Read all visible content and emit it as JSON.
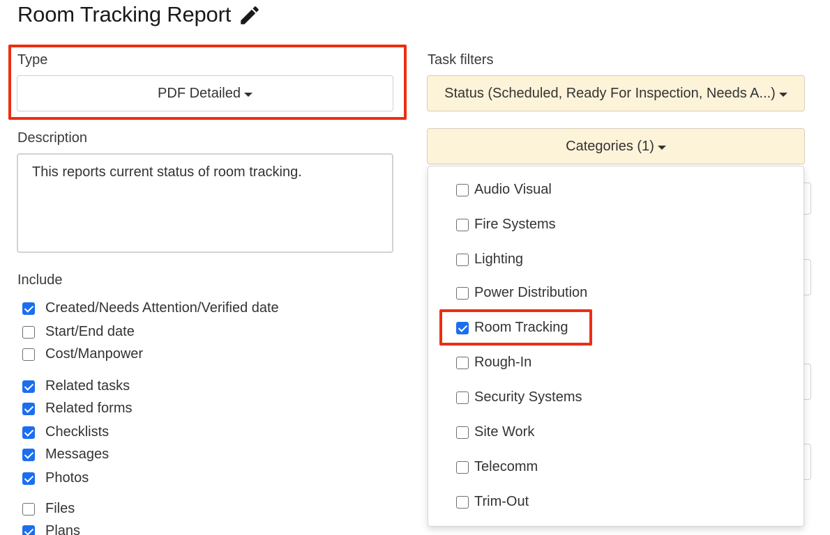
{
  "header": {
    "title": "Room Tracking Report"
  },
  "type": {
    "label": "Type",
    "value": "PDF Detailed"
  },
  "description": {
    "label": "Description",
    "value": "This reports current status of room tracking."
  },
  "include": {
    "label": "Include",
    "items": [
      {
        "label": "Created/Needs Attention/Verified date",
        "checked": true
      },
      {
        "label": "Start/End date",
        "checked": false
      },
      {
        "label": "Cost/Manpower",
        "checked": false
      },
      {
        "label": "Related tasks",
        "checked": true
      },
      {
        "label": "Related forms",
        "checked": true
      },
      {
        "label": "Checklists",
        "checked": true
      },
      {
        "label": "Messages",
        "checked": true
      },
      {
        "label": "Photos",
        "checked": true
      },
      {
        "label": "Files",
        "checked": false
      },
      {
        "label": "Plans",
        "checked": true
      }
    ]
  },
  "task_filters": {
    "label": "Task filters",
    "status_button": "Status (Scheduled, Ready For Inspection, Needs A...)",
    "categories_button": "Categories (1)",
    "categories": [
      {
        "label": "Audio Visual",
        "checked": false
      },
      {
        "label": "Fire Systems",
        "checked": false
      },
      {
        "label": "Lighting",
        "checked": false
      },
      {
        "label": "Power Distribution",
        "checked": false
      },
      {
        "label": "Room Tracking",
        "checked": true
      },
      {
        "label": "Rough-In",
        "checked": false
      },
      {
        "label": "Security Systems",
        "checked": false
      },
      {
        "label": "Site Work",
        "checked": false
      },
      {
        "label": "Telecomm",
        "checked": false
      },
      {
        "label": "Trim-Out",
        "checked": false
      }
    ]
  },
  "colors": {
    "highlight": "#ee2d12",
    "checkbox_accent": "#1c6ef0",
    "filter_button_bg": "#fdf3d9"
  },
  "icons": {
    "edit": "pencil-icon"
  }
}
